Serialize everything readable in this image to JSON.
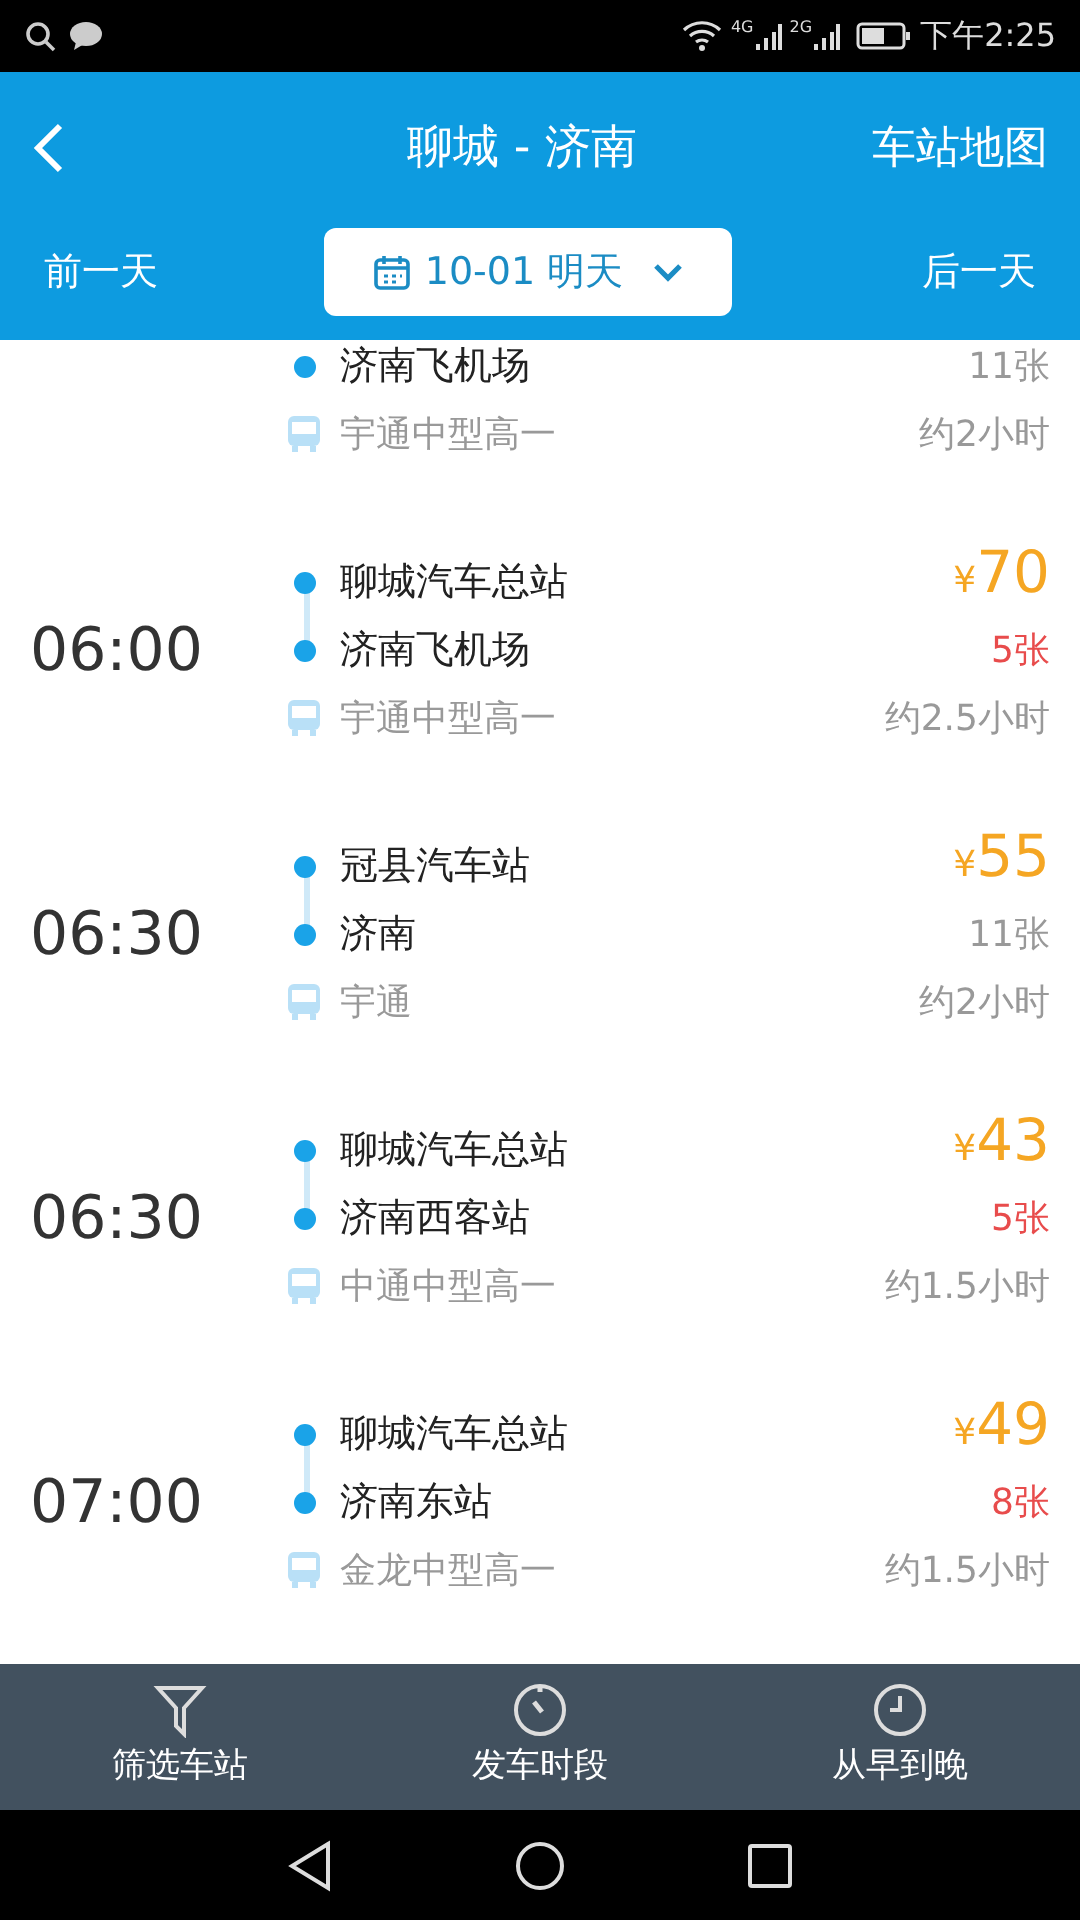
{
  "status_bar": {
    "time": "下午2:25",
    "network_1": "4G",
    "network_2": "2G"
  },
  "header": {
    "title": "聊城 - 济南",
    "map_link": "车站地图",
    "prev_day": "前一天",
    "date": "10-01 明天",
    "next_day": "后一天"
  },
  "trips": [
    {
      "stations": [
        "济南飞机场"
      ],
      "bus": "宇通中型高一",
      "seats": "11张",
      "few_left": false,
      "duration": "约2小时"
    },
    {
      "time": "06:00",
      "stations": [
        "聊城汽车总站",
        "济南飞机场"
      ],
      "bus": "宇通中型高一",
      "currency": "¥",
      "price": "70",
      "seats": "5张",
      "few_left": true,
      "duration": "约2.5小时"
    },
    {
      "time": "06:30",
      "stations": [
        "冠县汽车站",
        "济南"
      ],
      "bus": "宇通",
      "currency": "¥",
      "price": "55",
      "seats": "11张",
      "few_left": false,
      "duration": "约2小时"
    },
    {
      "time": "06:30",
      "stations": [
        "聊城汽车总站",
        "济南西客站"
      ],
      "bus": "中通中型高一",
      "currency": "¥",
      "price": "43",
      "seats": "5张",
      "few_left": true,
      "duration": "约1.5小时"
    },
    {
      "time": "07:00",
      "stations": [
        "聊城汽车总站",
        "济南东站"
      ],
      "bus": "金龙中型高一",
      "currency": "¥",
      "price": "49",
      "seats": "8张",
      "few_left": true,
      "duration": "约1.5小时"
    }
  ],
  "bottom_bar": [
    {
      "kind": "filter",
      "label": "筛选车站"
    },
    {
      "kind": "timer",
      "label": "发车时段"
    },
    {
      "kind": "clock",
      "label": "从早到晚"
    }
  ]
}
